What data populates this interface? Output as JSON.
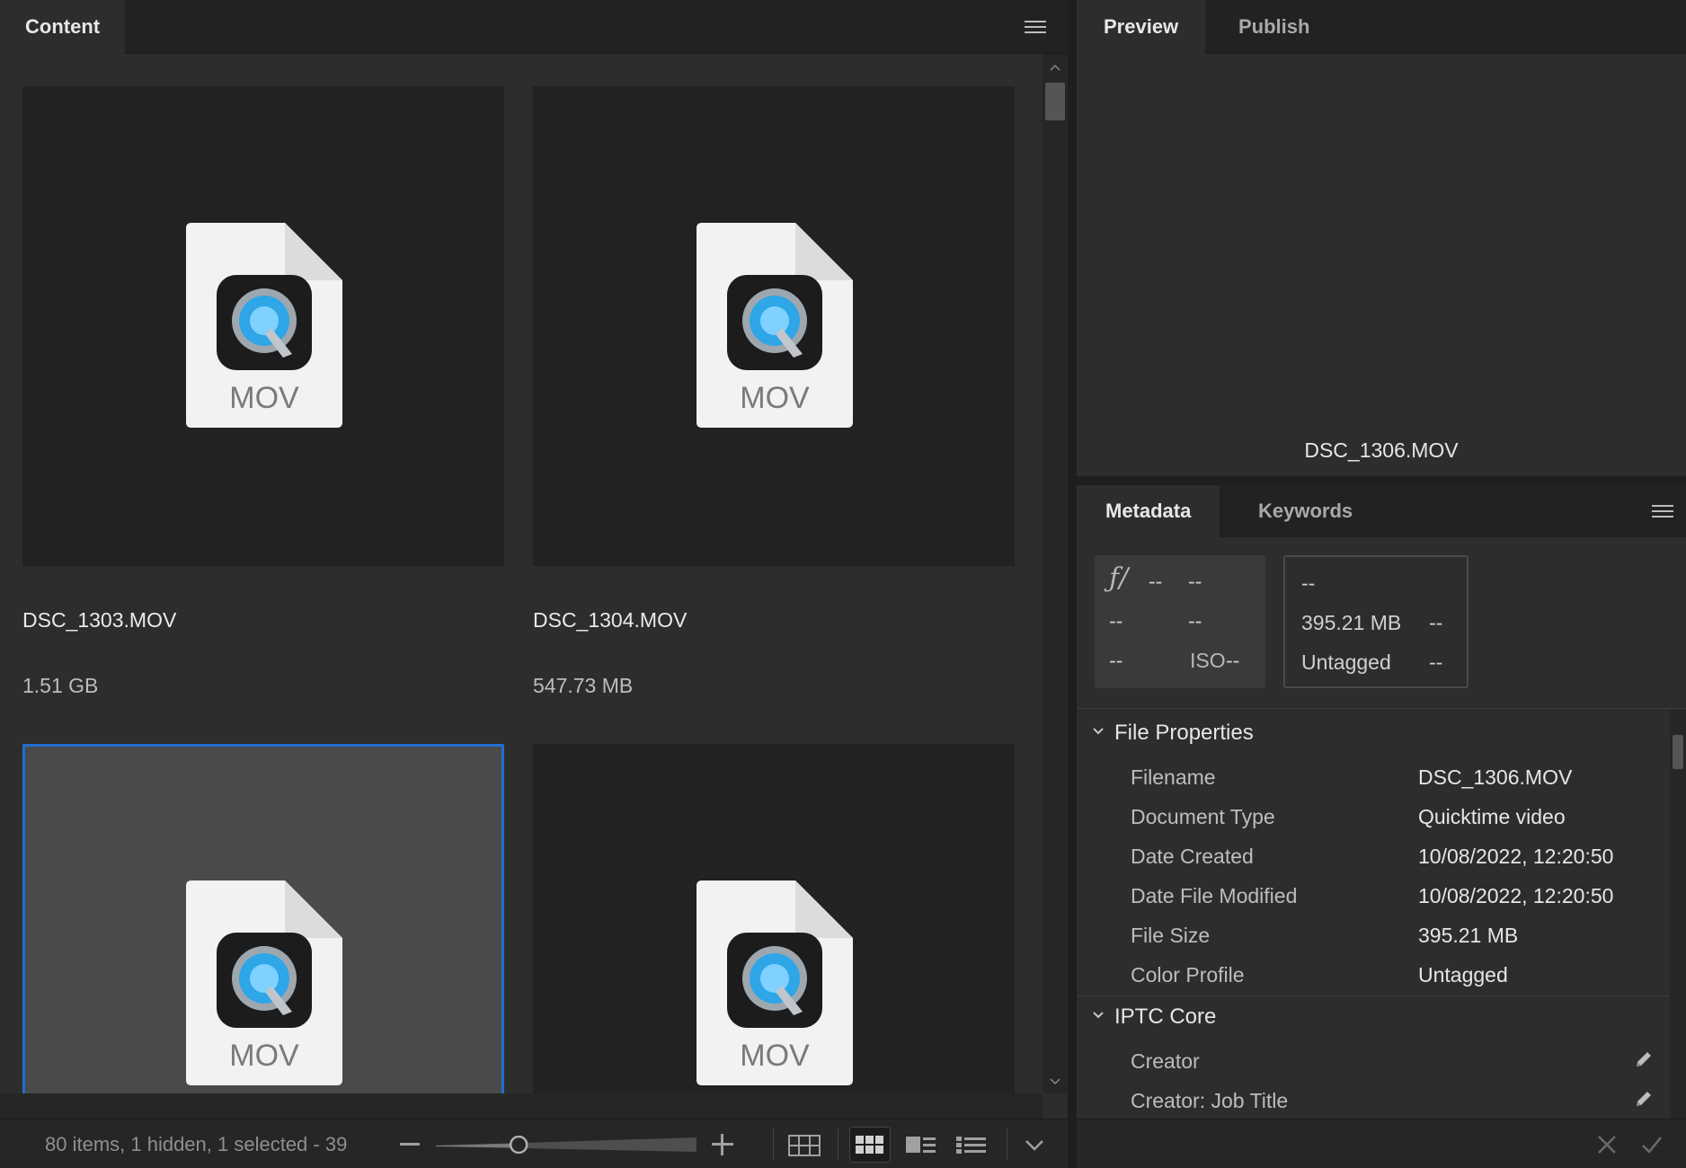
{
  "content_panel": {
    "tab_label": "Content",
    "items": [
      {
        "filename": "DSC_1303.MOV",
        "size": "1.51 GB",
        "icon_label": "MOV",
        "selected": false
      },
      {
        "filename": "DSC_1304.MOV",
        "size": "547.73 MB",
        "icon_label": "MOV",
        "selected": false
      },
      {
        "filename": "",
        "size": "",
        "icon_label": "MOV",
        "selected": true
      },
      {
        "filename": "",
        "size": "",
        "icon_label": "MOV",
        "selected": false
      }
    ]
  },
  "status_bar": {
    "text": "80 items, 1 hidden, 1 selected - 39",
    "thumbnail_size_fraction": 0.28
  },
  "preview_panel": {
    "tabs": [
      "Preview",
      "Publish"
    ],
    "active_tab": "Preview",
    "filename": "DSC_1306.MOV"
  },
  "metadata_panel": {
    "tabs": [
      "Metadata",
      "Keywords"
    ],
    "active_tab": "Metadata",
    "camera": {
      "aperture_symbol": "ƒ/",
      "aperture": "--",
      "shutter": "--",
      "r2c1": "--",
      "r2c2": "--",
      "r3c1": "--",
      "iso_label": "ISO",
      "iso": "--"
    },
    "file": {
      "r1c1": "--",
      "size": "395.21 MB",
      "r2c2": "--",
      "color": "Untagged",
      "r3c2": "--"
    },
    "sections": {
      "file_properties": {
        "title": "File Properties",
        "rows": [
          {
            "label": "Filename",
            "value": "DSC_1306.MOV"
          },
          {
            "label": "Document Type",
            "value": "Quicktime video"
          },
          {
            "label": "Date Created",
            "value": "10/08/2022, 12:20:50"
          },
          {
            "label": "Date File Modified",
            "value": "10/08/2022, 12:20:50"
          },
          {
            "label": "File Size",
            "value": "395.21 MB"
          },
          {
            "label": "Color Profile",
            "value": "Untagged"
          }
        ]
      },
      "iptc_core": {
        "title": "IPTC Core",
        "rows": [
          {
            "label": "Creator"
          },
          {
            "label": "Creator: Job Title"
          }
        ]
      }
    }
  },
  "colors": {
    "selection_border": "#1f6fd1",
    "panel_bg": "#2d2d2d",
    "tile_bg": "#222222"
  },
  "icons": [
    "hamburger-menu-icon",
    "quicktime-file-icon",
    "chevron-down-icon",
    "pencil-icon",
    "grid-view-icon",
    "thumbnail-view-icon",
    "filmstrip-view-icon",
    "list-view-icon",
    "close-icon",
    "checkmark-icon"
  ]
}
